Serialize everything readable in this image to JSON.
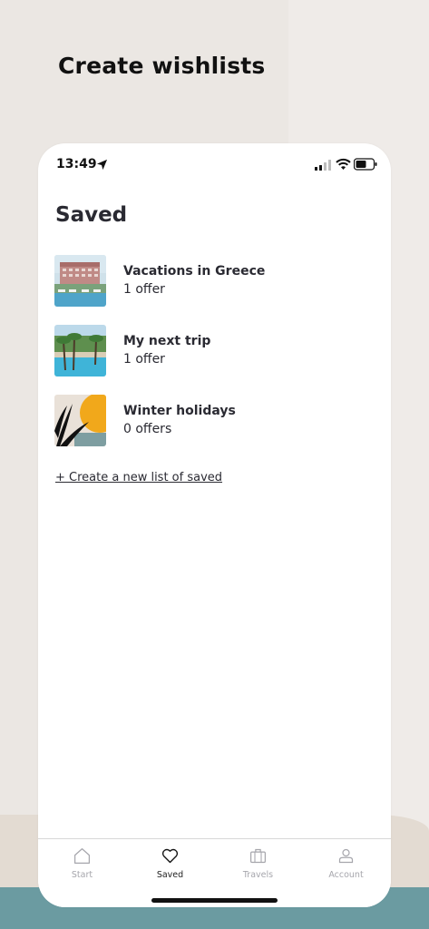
{
  "headline": "Create wishlists",
  "status_bar": {
    "time": "13:49",
    "icons": [
      "location-arrow-icon",
      "signal-icon",
      "wifi-icon",
      "battery-icon"
    ]
  },
  "page": {
    "title": "Saved",
    "lists": [
      {
        "title": "Vacations in Greece",
        "subtitle": "1 offer",
        "thumb": "hotel-photo"
      },
      {
        "title": "My next trip",
        "subtitle": "1 offer",
        "thumb": "pool-palms-photo"
      },
      {
        "title": "Winter holidays",
        "subtitle": "0 offers",
        "thumb": "abstract-leaf-sun-illustration"
      }
    ],
    "create_link": "+ Create a new list of saved"
  },
  "tabbar": {
    "tabs": [
      {
        "label": "Start",
        "icon": "home-icon",
        "active": false
      },
      {
        "label": "Saved",
        "icon": "heart-icon",
        "active": true
      },
      {
        "label": "Travels",
        "icon": "suitcase-icon",
        "active": false
      },
      {
        "label": "Account",
        "icon": "user-icon",
        "active": false
      }
    ]
  },
  "colors": {
    "background": "#ebe7e3",
    "teal_band": "#6b9ba1",
    "text": "#2a2a32",
    "inactive_tab": "#a6a6ac"
  }
}
